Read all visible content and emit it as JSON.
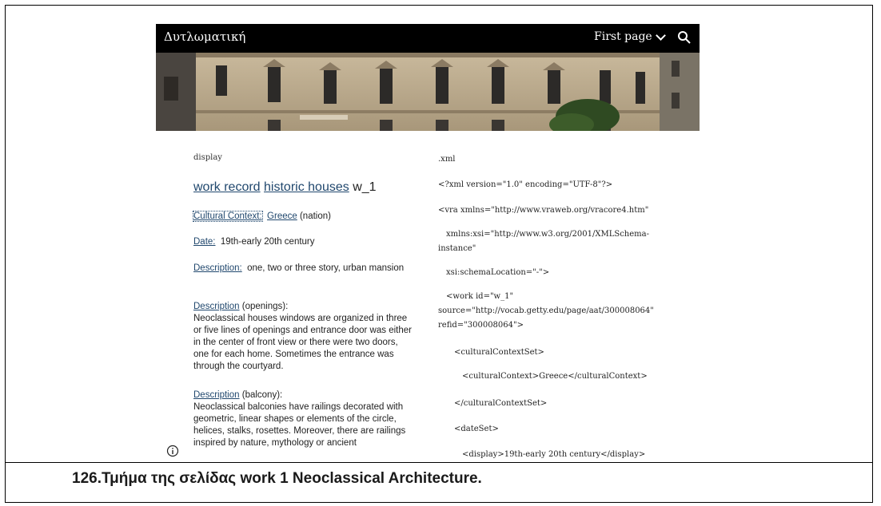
{
  "header": {
    "site_title": "Δυτλωματική",
    "nav_label": "First page"
  },
  "left": {
    "display_label": "display",
    "title_link1": "work record",
    "title_link2": "historic houses",
    "title_suffix": "w_1",
    "cultural_label": "Cultural Context:",
    "cultural_value_link": "Greece",
    "cultural_value_suffix": "(nation)",
    "date_label": "Date:",
    "date_value": "19th-early 20th century",
    "desc1_label": "Description:",
    "desc1_value": "one, two or three story, urban mansion",
    "desc2_label": "Description",
    "desc2_suffix": "(openings):",
    "desc2_text": "Neoclassical houses windows are organized in three or five lines of openings and entrance door was either in the center of front view or there were two doors, one for each home. Sometimes the entrance was through the courtyard.",
    "desc3_label": "Description",
    "desc3_suffix": "(balcony):",
    "desc3_text": "Neoclassical balconies have railings decorated with geometric, linear shapes or elements of the circle, helices, stalks, rosettes. Moreover, there are railings inspired by nature, mythology or ancient"
  },
  "right": {
    "heading": ".xml",
    "lines": [
      "<?xml version=\"1.0\" encoding=\"UTF-8\"?>",
      "<vra xmlns=\"http://www.vraweb.org/vracore4.htm\"",
      "xmlns:xsi=\"http://www.w3.org/2001/XMLSchema-",
      "instance\"",
      "xsi:schemaLocation=\"-\">",
      "<work id=\"w_1\"",
      "source=\"http://vocab.getty.edu/page/aat/300008064\"",
      "refid=\"300008064\">",
      "<culturalContextSet>",
      "<culturalContext>Greece</culturalContext>",
      "</culturalContextSet>",
      "<dateSet>",
      "<display>19th-early 20th century</display>"
    ]
  },
  "caption": "126.Τμήμα της σελίδας work 1 Neoclassical Architecture."
}
